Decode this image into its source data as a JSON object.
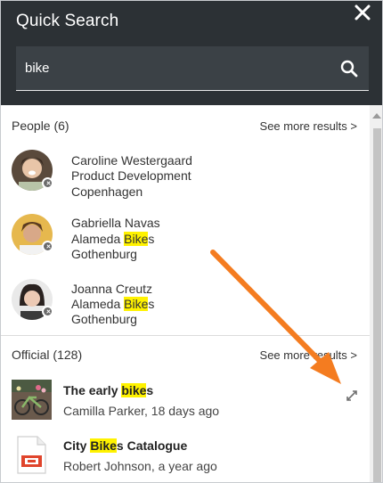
{
  "header": {
    "title": "Quick Search",
    "search_value": "bike",
    "search_icon": "search-icon",
    "close_icon": "close-icon"
  },
  "people": {
    "label": "People (6)",
    "more_label": "See more results >",
    "items": [
      {
        "name": "Caroline Westergaard",
        "dept_pre": "Product Development",
        "dept_hl": "",
        "dept_post": "",
        "city": "Copenhagen"
      },
      {
        "name": "Gabriella Navas",
        "dept_pre": "Alameda ",
        "dept_hl": "Bike",
        "dept_post": "s",
        "city": "Gothenburg"
      },
      {
        "name": "Joanna Creutz",
        "dept_pre": "Alameda ",
        "dept_hl": "Bike",
        "dept_post": "s",
        "city": "Gothenburg"
      }
    ]
  },
  "official": {
    "label": "Official (128)",
    "more_label": "See more results >",
    "items": [
      {
        "title_pre": "The early ",
        "title_hl": "bike",
        "title_post": "s",
        "subtitle": "Camilla Parker, 18 days ago"
      },
      {
        "title_pre": "City ",
        "title_hl": "Bike",
        "title_post": "s Catalogue",
        "subtitle": "Robert Johnson, a year ago"
      }
    ]
  },
  "colors": {
    "header_bg": "#2c3135",
    "highlight": "#fff200",
    "arrow": "#f47c20"
  }
}
